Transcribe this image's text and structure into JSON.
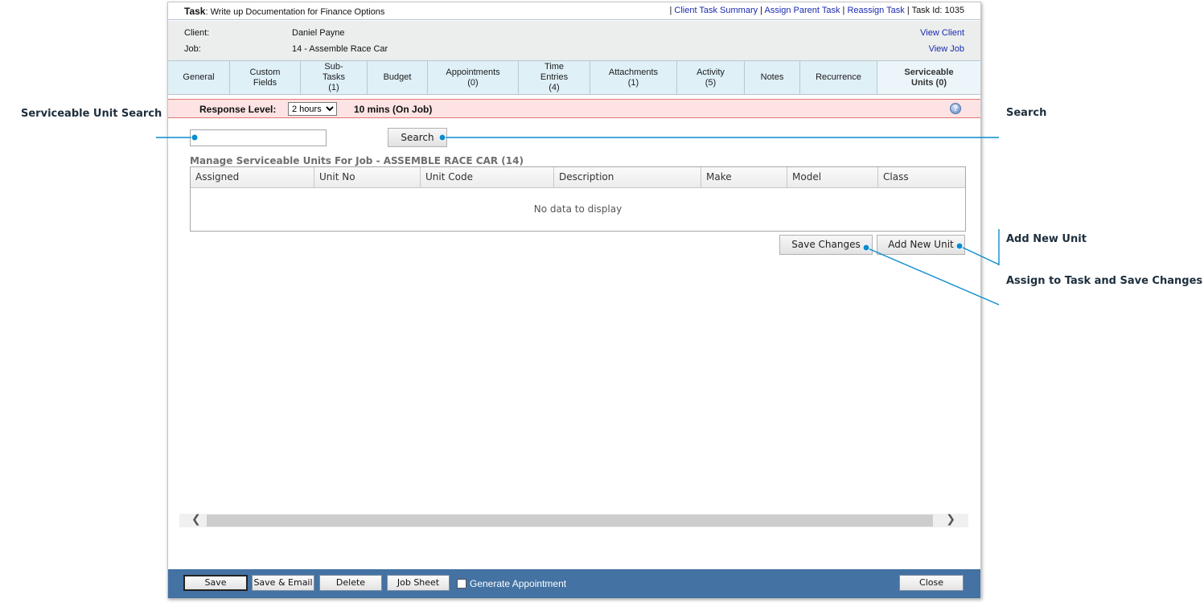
{
  "header": {
    "task_label": "Task",
    "task_title": ": Write up Documentation for Finance Options",
    "links": [
      "Client Task Summary",
      "Assign Parent Task",
      "Reassign Task"
    ],
    "task_id": "Task Id: 1035"
  },
  "info": {
    "client_label": "Client:",
    "client_value": "Daniel Payne",
    "job_label": "Job:",
    "job_value": "14 - Assemble Race Car",
    "view_client": "View Client",
    "view_job": "View Job"
  },
  "tabs": [
    {
      "label": "General"
    },
    {
      "label": "Custom\nFields"
    },
    {
      "label": "Sub-\nTasks\n(1)"
    },
    {
      "label": "Budget"
    },
    {
      "label": "Appointments\n(0)"
    },
    {
      "label": "Time\nEntries\n(4)"
    },
    {
      "label": "Attachments\n(1)"
    },
    {
      "label": "Activity\n(5)"
    },
    {
      "label": "Notes"
    },
    {
      "label": "Recurrence"
    },
    {
      "label": "Serviceable\nUnits (0)",
      "active": true
    }
  ],
  "response": {
    "label": "Response Level:",
    "selected": "2 hours",
    "on_job": "10 mins (On Job)",
    "help_icon": "help-icon"
  },
  "search": {
    "value": "",
    "button": "Search"
  },
  "grid": {
    "title": "Manage Serviceable Units For Job - ASSEMBLE RACE CAR (14)",
    "columns": [
      "Assigned",
      "Unit No",
      "Unit Code",
      "Description",
      "Make",
      "Model",
      "Class"
    ],
    "empty_text": "No data to display"
  },
  "actions": {
    "save_changes": "Save Changes",
    "add_new_unit": "Add New Unit"
  },
  "footer": {
    "save": "Save",
    "save_email": "Save & Email",
    "delete": "Delete",
    "job_sheet": "Job Sheet",
    "generate_appointment": "Generate Appointment",
    "close": "Close"
  },
  "callouts": {
    "serviceable_unit_search": "Serviceable Unit Search",
    "search": "Search",
    "add_new_unit": "Add New Unit",
    "assign_save": "Assign to Task and Save Changes"
  },
  "colors": {
    "accent": "#0a8ccf",
    "footer": "#4372a3",
    "tab_bg": "#dff0f7",
    "response_bg": "#fde3e3"
  }
}
